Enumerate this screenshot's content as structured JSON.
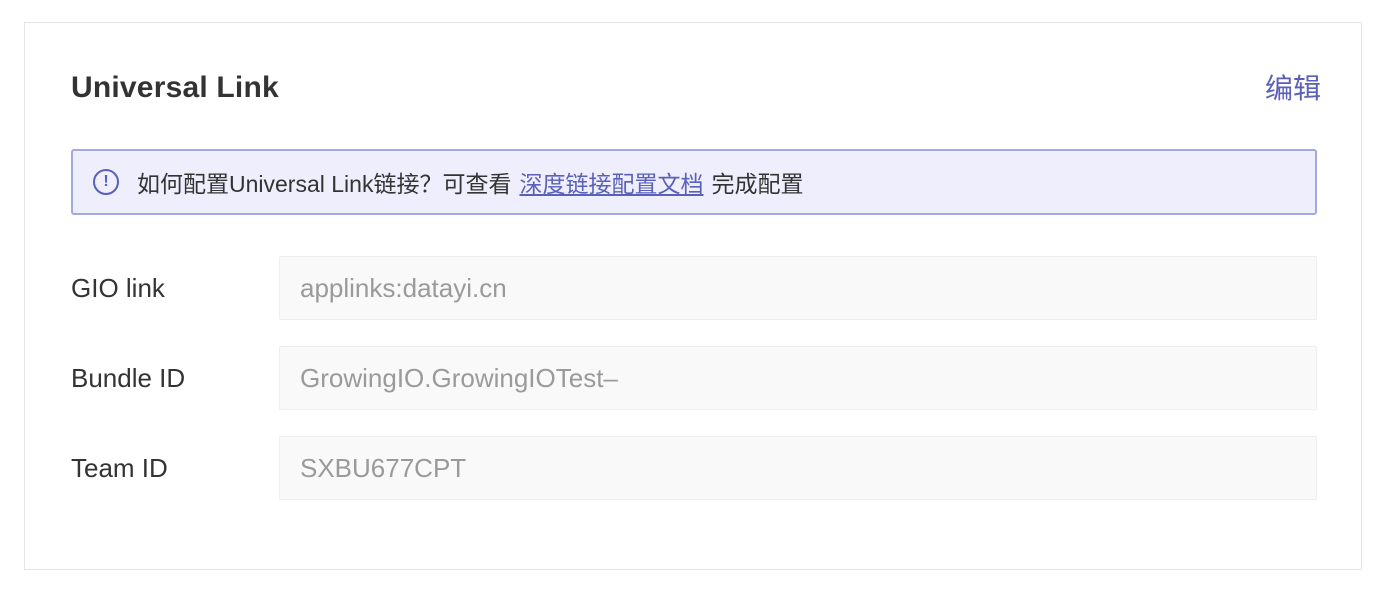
{
  "card": {
    "title": "Universal Link",
    "edit_label": "编辑"
  },
  "notice": {
    "icon": "info-circle-icon",
    "prefix": "如何配置Universal Link链接？可查看",
    "link_text": "深度链接配置文档",
    "suffix": "完成配置"
  },
  "fields": [
    {
      "label": "GIO link",
      "value": "applinks:datayi.cn"
    },
    {
      "label": "Bundle ID",
      "value": "GrowingIO.GrowingIOTest–"
    },
    {
      "label": "Team ID",
      "value": "SXBU677CPT"
    }
  ],
  "colors": {
    "accent": "#5a60b8",
    "notice_bg": "#eeeefd",
    "notice_border": "#a5a8e0",
    "input_bg": "#f9f9f9"
  }
}
